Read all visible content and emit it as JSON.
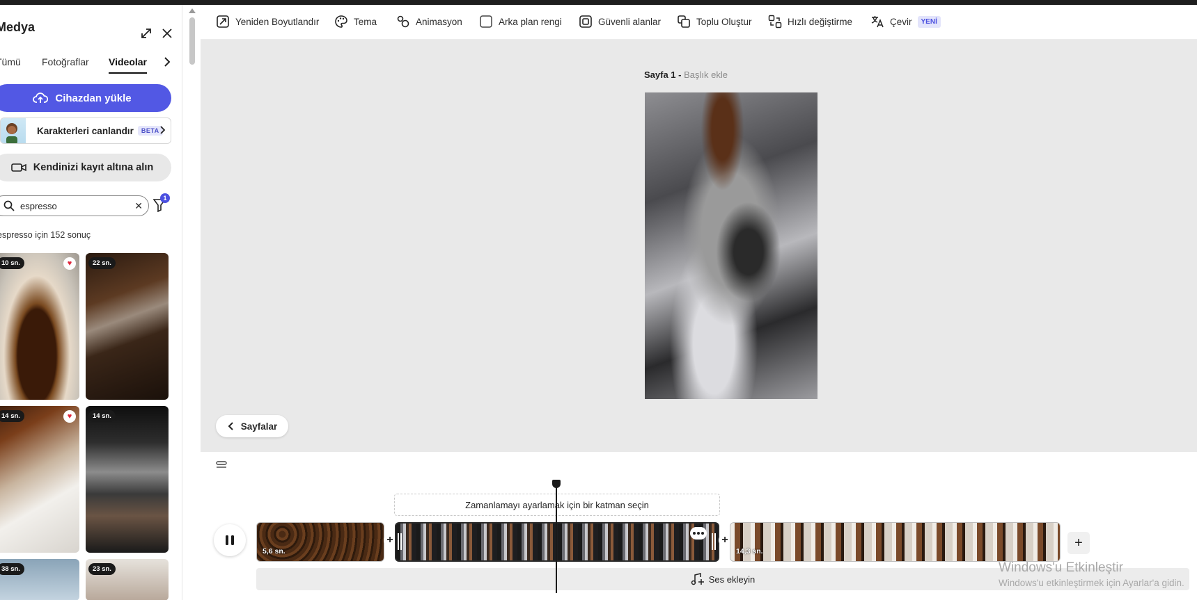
{
  "left_panel": {
    "title": "Medya",
    "tabs": [
      "Tümü",
      "Fotoğraflar",
      "Videolar"
    ],
    "active_tab": "Videolar",
    "upload_label": "Cihazdan yükle",
    "animate_label": "Karakterleri canlandır",
    "animate_badge": "BETA",
    "record_label": "Kendinizi kayıt altına alın",
    "search_value": "espresso",
    "filter_count": "1",
    "results_text": "espresso için 152 sonuç",
    "videos": [
      {
        "duration": "10 sn.",
        "favorite": true
      },
      {
        "duration": "22 sn.",
        "favorite": false
      },
      {
        "duration": "14 sn.",
        "favorite": true
      },
      {
        "duration": "14 sn.",
        "favorite": false
      },
      {
        "duration": "38 sn.",
        "favorite": false
      },
      {
        "duration": "23 sn.",
        "favorite": false
      }
    ]
  },
  "toolbar": {
    "items": [
      {
        "label": "Yeniden Boyutlandır",
        "icon": "resize-icon"
      },
      {
        "label": "Tema",
        "icon": "palette-icon"
      },
      {
        "label": "Animasyon",
        "icon": "animation-icon"
      },
      {
        "label": "Arka plan rengi",
        "icon": "background-color-icon"
      },
      {
        "label": "Güvenli alanlar",
        "icon": "safe-area-icon"
      },
      {
        "label": "Toplu Oluştur",
        "icon": "bulk-create-icon"
      },
      {
        "label": "Hızlı değiştirme",
        "icon": "quick-swap-icon"
      },
      {
        "label": "Çevir",
        "icon": "translate-icon"
      }
    ],
    "translate_badge": "YENİ"
  },
  "canvas": {
    "page_label": "Sayfa 1 -",
    "page_title_placeholder": "Başlık ekle",
    "pages_button": "Sayfalar"
  },
  "timeline": {
    "hint": "Zamanlamayı ayarlamak için bir katman seçin",
    "clips": [
      {
        "duration": "5,6 sn."
      },
      {
        "duration": ""
      },
      {
        "duration": "14,3 sn."
      }
    ],
    "audio_label": "Ses ekleyin"
  },
  "watermark": {
    "line1": "Windows'u Etkinleştir",
    "line2": "Windows'u etkinleştirmek için Ayarlar'a gidin."
  },
  "colors": {
    "accent": "#5258e4",
    "canvas_bg": "#e9e9e9",
    "favorite": "#e0263b"
  }
}
